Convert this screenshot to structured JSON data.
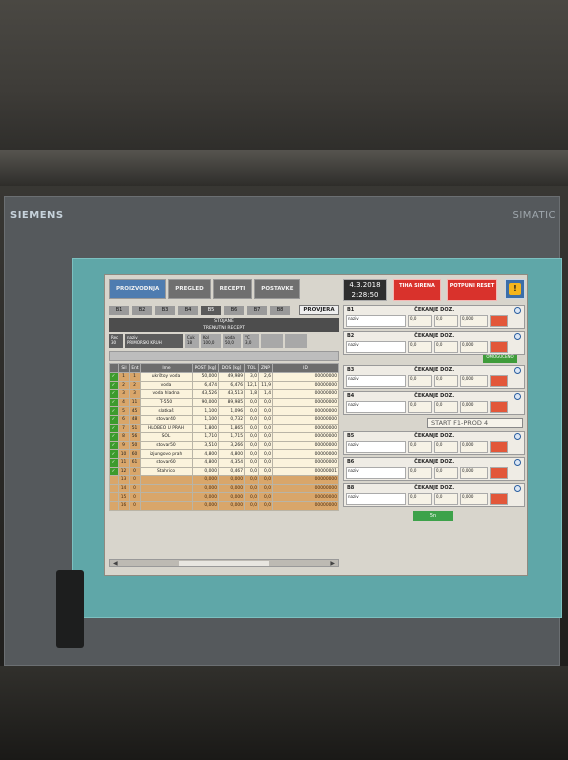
{
  "device": {
    "brand": "SIEMENS",
    "model": "SIMATIC"
  },
  "nav": {
    "tabs": [
      "PROIZVODNJA",
      "PREGLED",
      "RECEPTI",
      "POSTAVKE"
    ],
    "active": "PROIZVODNJA"
  },
  "header": {
    "date": "4.3.2018",
    "time": "2:28:50",
    "alarm_btn": "TIHA SIRENA",
    "reset_btn": "POTPUNI RESET",
    "warning_icon": "warning-icon"
  },
  "bins": [
    "B1",
    "B2",
    "B3",
    "B4",
    "B5",
    "B6",
    "B7",
    "B8"
  ],
  "provjera": "PROVJERA",
  "recipe_header": {
    "line1": "STOJANE",
    "line2": "TRENUTNI RECEPT"
  },
  "inputs": [
    {
      "label": "Rec",
      "value": "30"
    },
    {
      "label": "naziv",
      "value": "PRIMORSKI KRUH"
    },
    {
      "label": "Cuk",
      "value": "18"
    },
    {
      "label": "Kol",
      "value": "100,0"
    },
    {
      "label": "voda",
      "value": "50,0"
    },
    {
      "label": "°C",
      "value": "3,0"
    }
  ],
  "table": {
    "columns": [
      "",
      "Sil",
      "Ent",
      "Ime",
      "POST [kg]",
      "DOS [kg]",
      "TOL",
      "ZNP",
      "ID"
    ],
    "rows": [
      [
        "✓",
        "1",
        "1",
        "ukrštoy voda",
        "50,000",
        "49,989",
        "3,0",
        "2,6",
        "00000000"
      ],
      [
        "✓",
        "2",
        "2",
        "voda",
        "6,474",
        "6,476",
        "12,1",
        "11,9",
        "00000000"
      ],
      [
        "✓",
        "3",
        "3",
        "voda hladna",
        "43,526",
        "43,513",
        "1,8",
        "1,4",
        "00000000"
      ],
      [
        "✓",
        "4",
        "11",
        "T-550",
        "90,000",
        "89,985",
        "0,0",
        "0,0",
        "00000000"
      ],
      [
        "✓",
        "5",
        "45",
        "slatkaš",
        "1,100",
        "1,096",
        "0,0",
        "0,0",
        "00000000"
      ],
      [
        "✓",
        "6",
        "48",
        "stovar40",
        "1,100",
        "0,732",
        "0,0",
        "0,0",
        "00000000"
      ],
      [
        "✓",
        "7",
        "51",
        "HLOBEO U PRAH",
        "1,800",
        "1,865",
        "0,0",
        "0,0",
        "00000000"
      ],
      [
        "✓",
        "8",
        "56",
        "SOL",
        "1,710",
        "1,715",
        "0,0",
        "0,0",
        "00000000"
      ],
      [
        "✓",
        "9",
        "50",
        "stovar50",
        "3,510",
        "3,266",
        "0,0",
        "0,0",
        "00000000"
      ],
      [
        "✓",
        "10",
        "60",
        "izjungovo prah",
        "4,800",
        "4,800",
        "0,0",
        "0,0",
        "00000000"
      ],
      [
        "✓",
        "11",
        "61",
        "stovar60",
        "4,800",
        "4,354",
        "0,0",
        "0,0",
        "00000000"
      ],
      [
        "✓",
        "12",
        "0",
        "Stahrico",
        "0,000",
        "0,467",
        "0,0",
        "0,0",
        "00000001"
      ],
      [
        "",
        "13",
        "0",
        "",
        "0,000",
        "0,000",
        "0,0",
        "0,0",
        "00000000"
      ],
      [
        "",
        "14",
        "0",
        "",
        "0,000",
        "0,000",
        "0,0",
        "0,0",
        "00000000"
      ],
      [
        "",
        "15",
        "0",
        "",
        "0,000",
        "0,000",
        "0,0",
        "0,0",
        "00000000"
      ],
      [
        "",
        "16",
        "0",
        "",
        "0,000",
        "0,000",
        "0,0",
        "0,0",
        "00000000"
      ]
    ]
  },
  "doses": [
    {
      "id": "B1",
      "title": "ČEKANJE DOZ.",
      "label": "naziv",
      "v1": "0,0",
      "v2": "0,0",
      "v3": "0,000"
    },
    {
      "id": "B2",
      "title": "ČEKANJE DOZ.",
      "label": "naziv",
      "v1": "0,0",
      "v2": "0,0",
      "v3": "0,000"
    },
    {
      "id": "B3",
      "title": "ČEKANJE DOZ.",
      "label": "naziv",
      "v1": "0,0",
      "v2": "0,0",
      "v3": "0,000"
    },
    {
      "id": "B4",
      "title": "ČEKANJE DOZ.",
      "label": "naziv",
      "v1": "0,0",
      "v2": "0,0",
      "v3": "0,000"
    },
    {
      "id": "B5",
      "title": "ČEKANJE DOZ.",
      "label": "naziv",
      "v1": "0,0",
      "v2": "0,0",
      "v3": "0,000"
    },
    {
      "id": "B6",
      "title": "ČEKANJE DOZ.",
      "label": "naziv",
      "v1": "0,0",
      "v2": "0,0",
      "v3": "0,000"
    },
    {
      "id": "B8",
      "title": "ČEKANJE DOZ.",
      "label": "naziv",
      "v1": "0,0",
      "v2": "0,0",
      "v3": "0,000"
    }
  ],
  "green_status": "OMOGUĆENO",
  "start_select": "START F1-PROD 4",
  "ok_button": "5n"
}
